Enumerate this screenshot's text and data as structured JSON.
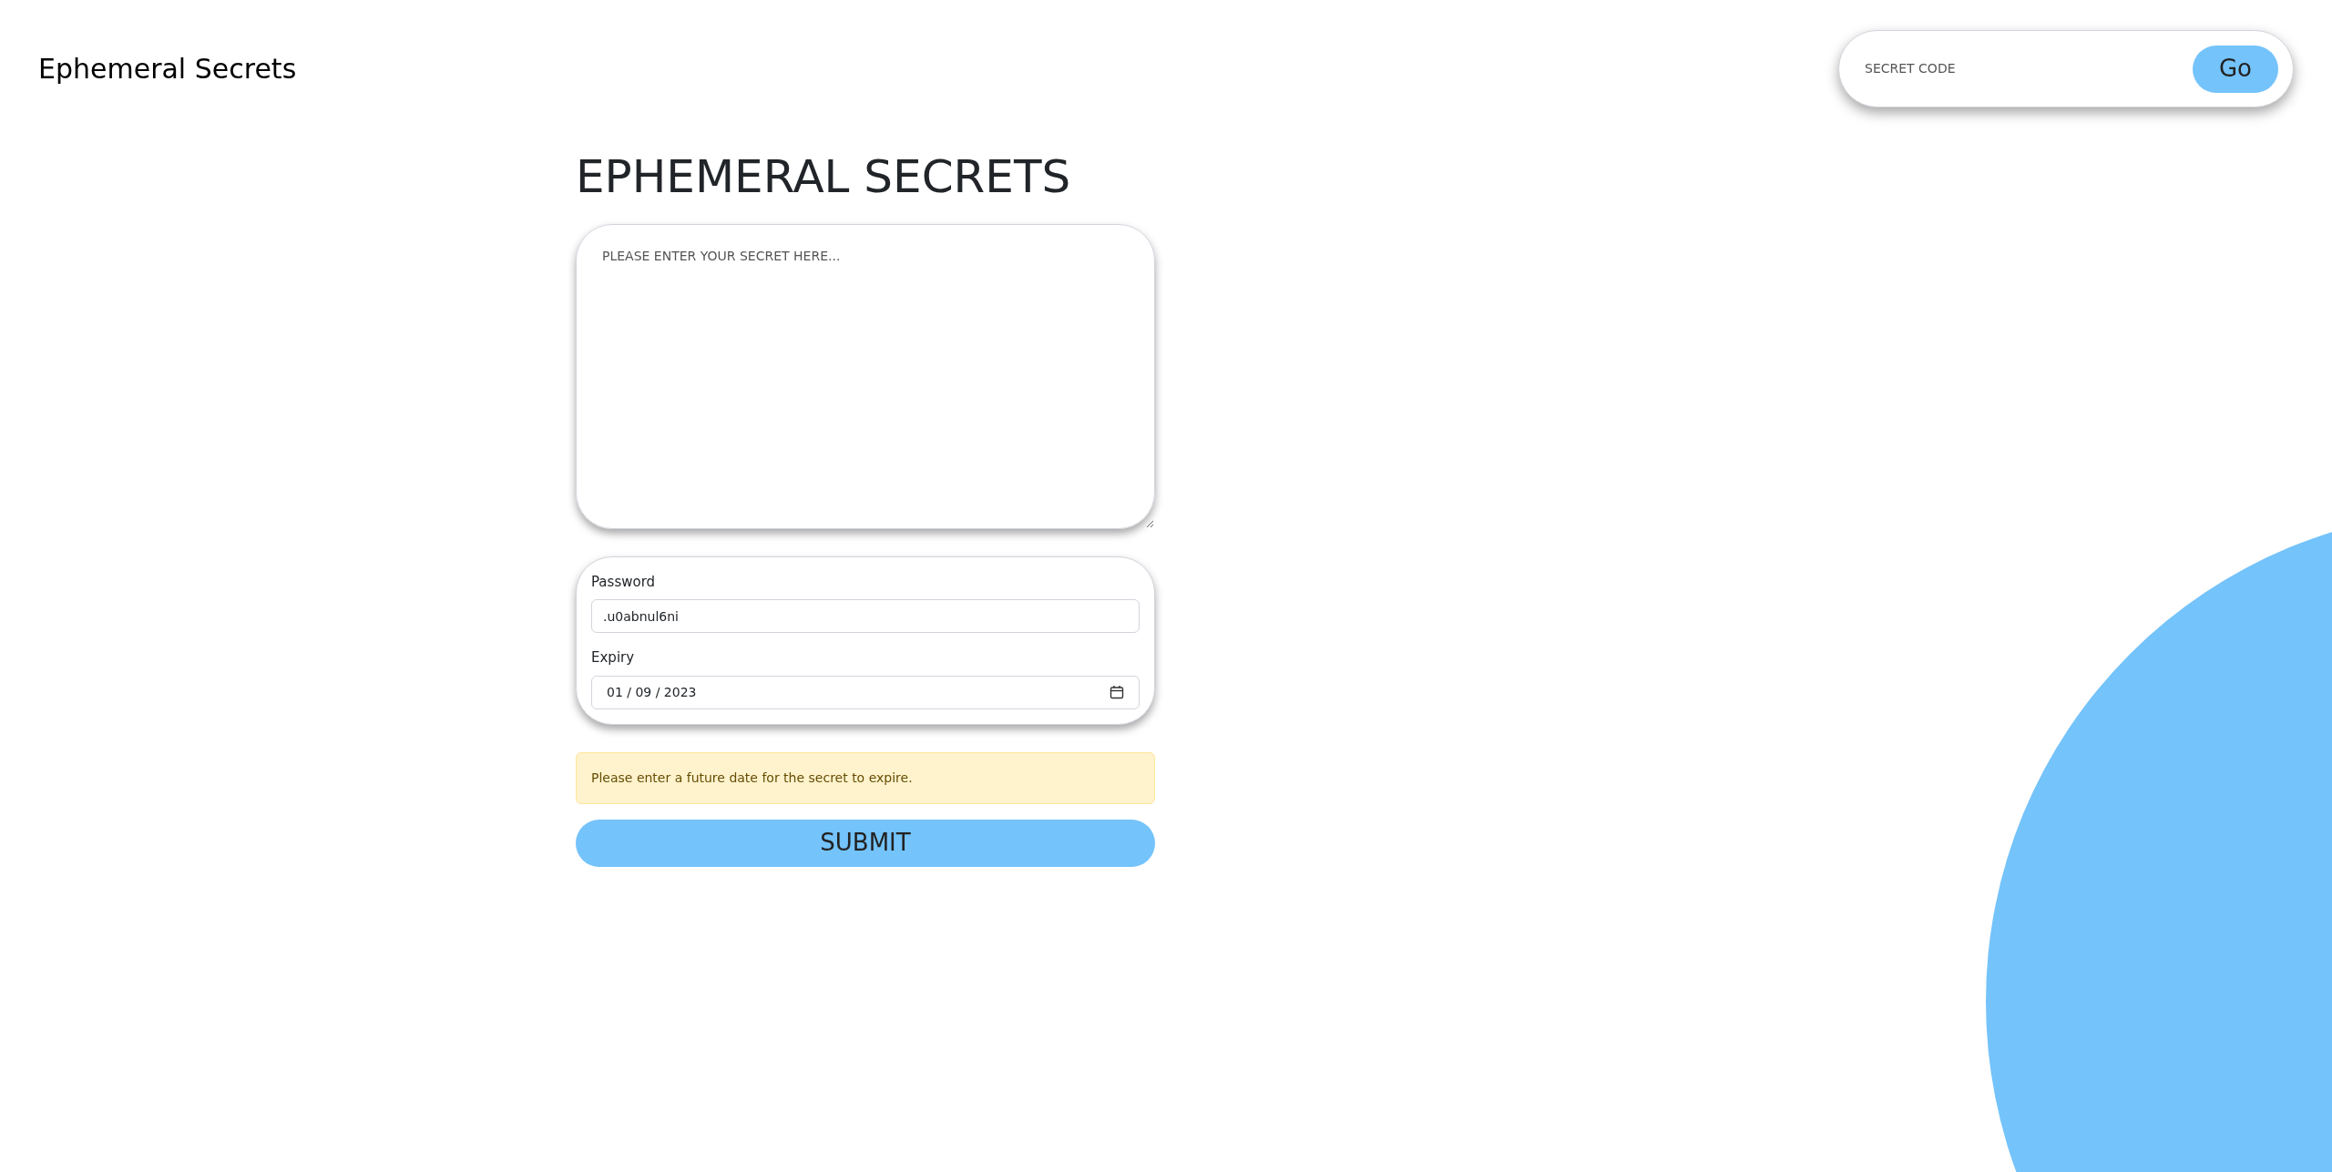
{
  "header": {
    "brand": "Ephemeral Secrets",
    "search": {
      "placeholder": "SECRET CODE",
      "button": "Go"
    }
  },
  "heading": "EPHEMERAL SECRETS",
  "secret": {
    "placeholder": "PLEASE ENTER YOUR SECRET HERE..."
  },
  "password": {
    "label": "Password",
    "value": ".u0abnul6ni"
  },
  "expiry": {
    "label": "Expiry",
    "value": "01 / 09 / 2023"
  },
  "alert": "Please enter a future date for the secret to expire.",
  "submit": "SUBMIT"
}
